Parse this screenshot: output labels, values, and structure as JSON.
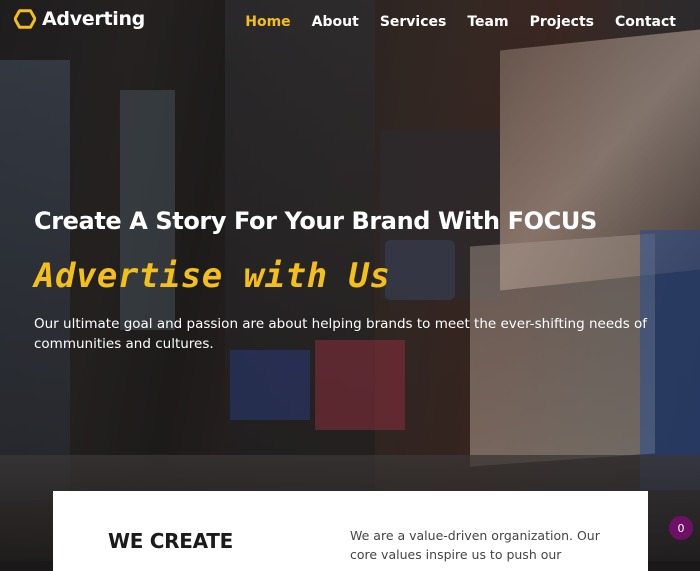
{
  "header": {
    "brand": "Adverting",
    "logo_icon": "hexagon-icon",
    "accent_color": "#f5bf1a"
  },
  "nav": {
    "items": [
      {
        "label": "Home",
        "active": true
      },
      {
        "label": "About",
        "active": false
      },
      {
        "label": "Services",
        "active": false
      },
      {
        "label": "Team",
        "active": false
      },
      {
        "label": "Projects",
        "active": false
      },
      {
        "label": "Contact",
        "active": false
      }
    ]
  },
  "hero": {
    "title": "Create A Story For Your Brand With FOCUS",
    "script_heading": "Advertise with Us",
    "description": "Our ultimate goal and passion are about helping brands to meet the ever-shifting needs of communities and cultures."
  },
  "about": {
    "heading": "WE CREATE",
    "text": "We are a value-driven organization. Our core values inspire us to push our"
  },
  "notification_badge": {
    "count": "0",
    "color": "#6e1166"
  }
}
